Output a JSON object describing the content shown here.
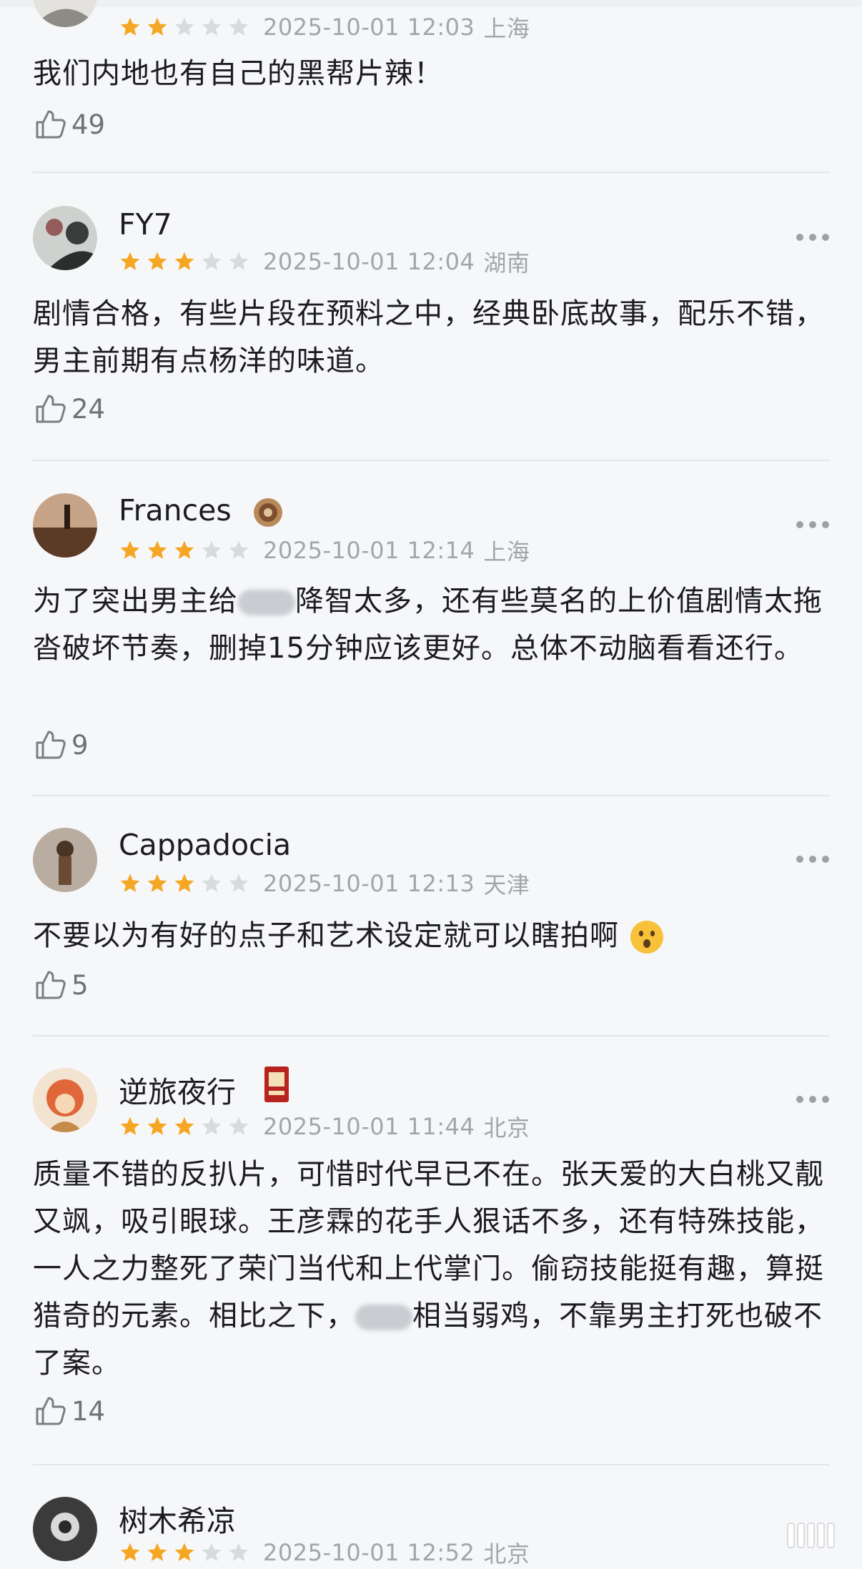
{
  "reviews": [
    {
      "user": "",
      "rating": 2,
      "date": "2025-10-01 12:03",
      "location": "上海",
      "content_parts": [
        "我们内地也有自己的黑帮片辣！"
      ],
      "likes": "49"
    },
    {
      "user": "FY7",
      "rating": 3,
      "date": "2025-10-01 12:04",
      "location": "湖南",
      "content_parts": [
        "剧情合格，有些片段在预料之中，经典卧底故事，配乐不错，男主前期有点杨洋的味道。"
      ],
      "likes": "24"
    },
    {
      "user": "Frances",
      "rating": 3,
      "date": "2025-10-01 12:14",
      "location": "上海",
      "content_parts": [
        "为了突出男主给",
        "降智太多，还有些莫名的上价值剧情太拖沓破坏节奏，删掉15分钟应该更好。总体不动脑看看还行。"
      ],
      "likes": "9"
    },
    {
      "user": "Cappadocia",
      "rating": 3,
      "date": "2025-10-01 12:13",
      "location": "天津",
      "content_parts": [
        "不要以为有好的点子和艺术设定就可以瞎拍啊"
      ],
      "likes": "5"
    },
    {
      "user": "逆旅夜行",
      "rating": 3,
      "date": "2025-10-01 11:44",
      "location": "北京",
      "content_parts": [
        "质量不错的反扒片，可惜时代早已不在。张天爱的大白桃又靓又飒，吸引眼球。王彦霖的花手人狠话不多，还有特殊技能，一人之力整死了荣门当代和上代掌门。偷窃技能挺有趣，算挺猎奇的元素。相比之下，",
        "相当弱鸡，不靠男主打死也破不了案。"
      ],
      "likes": "14"
    },
    {
      "user": "树木希凉",
      "rating": 3,
      "date": "2025-10-01 12:52",
      "location": "北京"
    }
  ],
  "colors": {
    "star_filled": "#f5a623",
    "star_empty": "#d8dadd",
    "meta": "#a2a5ab",
    "divider": "#e3e5e8",
    "background": "#f6f7f9"
  },
  "icons": {
    "like": "thumbs-up-outline-icon",
    "more": "more-dots-icon",
    "star": "star-icon",
    "emoji": "surprised-face-emoji"
  }
}
